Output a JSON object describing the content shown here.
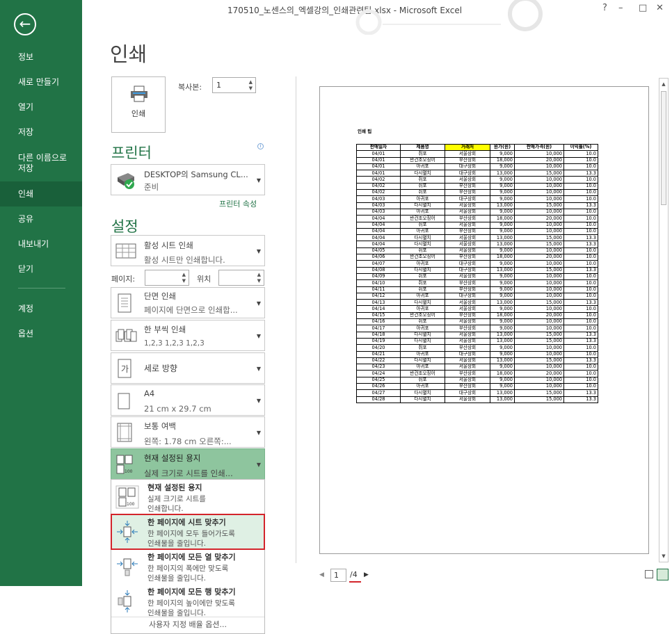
{
  "window": {
    "title": "170510_노센스의_엑셀강의_인쇄관련팁.xlsx - Microsoft Excel",
    "help": "?",
    "minimize": "–",
    "restore": "□",
    "close": "✕"
  },
  "nav": {
    "back_icon": "←",
    "items": [
      {
        "label": "정보"
      },
      {
        "label": "새로 만들기"
      },
      {
        "label": "열기"
      },
      {
        "label": "저장"
      },
      {
        "label": "다른 이름으로 저장"
      },
      {
        "label": "인쇄",
        "active": true
      },
      {
        "label": "공유"
      },
      {
        "label": "내보내기"
      },
      {
        "label": "닫기"
      },
      {
        "label": "계정"
      },
      {
        "label": "옵션"
      }
    ]
  },
  "print": {
    "heading": "인쇄",
    "print_button_label": "인쇄",
    "copies_label": "복사본:",
    "copies_value": "1",
    "printer_heading": "프린터",
    "printer_name": "DESKTOP의 Samsung CL...",
    "printer_status": "준비",
    "printer_properties": "프린터 속성",
    "settings_heading": "설정",
    "settings": {
      "what": {
        "line1": "활성 시트 인쇄",
        "line2": "활성 시트만 인쇄합니다."
      },
      "pages_label": "페이지:",
      "pages_to_label": "위치",
      "sides": {
        "line1": "단면 인쇄",
        "line2": "페이지에 단면으로 인쇄합..."
      },
      "collate": {
        "line1": "한 부씩 인쇄",
        "line2": "1,2,3    1,2,3    1,2,3"
      },
      "orientation": {
        "line1": "세로 방향"
      },
      "paper": {
        "line1": "A4",
        "line2": "21 cm x 29.7 cm"
      },
      "margins": {
        "line1": "보통 여백",
        "line2": "왼쪽:  1.78 cm    오른쪽:..."
      },
      "scaling": {
        "line1": "현재 설정된 용지",
        "line2": "실제 크기로 시트를 인쇄..."
      }
    },
    "scaling_options": [
      {
        "title": "현재 설정된 용지",
        "desc1": "실제 크기로 시트를",
        "desc2": "인쇄합니다."
      },
      {
        "title": "한 페이지에 시트 맞추기",
        "desc1": "한 페이지에 모두 들어가도록",
        "desc2": "인쇄물을 줄입니다."
      },
      {
        "title": "한 페이지에 모든 열 맞추기",
        "desc1": "한 페이지의 폭에만 맞도록",
        "desc2": "인쇄물을 줄입니다."
      },
      {
        "title": "한 페이지에 모든 행 맞추기",
        "desc1": "한 페이지의 높이에만 맞도록",
        "desc2": "인쇄물을 줄입니다."
      }
    ],
    "custom_scaling": "사용자 지정 배율 옵션..."
  },
  "preview": {
    "sheet_title": "인쇄 팁",
    "headers": [
      "판매일자",
      "제품명",
      "거래처",
      "원가(원)",
      "판매가격(원)",
      "이익률(%)"
    ],
    "highlight_header_color": "#ffff00",
    "rows": [
      [
        "04/01",
        "쥐포",
        "서울상회",
        "9,000",
        "10,000",
        "10.0"
      ],
      [
        "04/01",
        "반건조오징어",
        "부산상회",
        "18,000",
        "20,000",
        "10.0"
      ],
      [
        "04/01",
        "아귀포",
        "대구상회",
        "9,000",
        "10,000",
        "10.0"
      ],
      [
        "04/01",
        "다시멸치",
        "대구상회",
        "13,000",
        "15,000",
        "13.3"
      ],
      [
        "04/02",
        "쥐포",
        "서울상회",
        "9,000",
        "10,000",
        "10.0"
      ],
      [
        "04/02",
        "쥐포",
        "부산상회",
        "9,000",
        "10,000",
        "10.0"
      ],
      [
        "04/02",
        "쥐포",
        "부산상회",
        "9,000",
        "10,000",
        "10.0"
      ],
      [
        "04/03",
        "아귀포",
        "대구상회",
        "9,000",
        "10,000",
        "10.0"
      ],
      [
        "04/03",
        "다시멸치",
        "서울상회",
        "13,000",
        "15,000",
        "13.3"
      ],
      [
        "04/03",
        "아귀포",
        "서울상회",
        "9,000",
        "10,000",
        "10.0"
      ],
      [
        "04/04",
        "반건조오징어",
        "부산상회",
        "18,000",
        "20,000",
        "10.0"
      ],
      [
        "04/04",
        "쥐포",
        "서울상회",
        "9,000",
        "10,000",
        "10.0"
      ],
      [
        "04/04",
        "아귀포",
        "부산상회",
        "9,000",
        "10,000",
        "10.0"
      ],
      [
        "04/04",
        "다시멸치",
        "서울상회",
        "13,000",
        "15,000",
        "13.3"
      ],
      [
        "04/04",
        "다시멸치",
        "서울상회",
        "13,000",
        "15,000",
        "13.3"
      ],
      [
        "04/05",
        "쥐포",
        "서울상회",
        "9,000",
        "10,000",
        "10.0"
      ],
      [
        "04/06",
        "반건조오징어",
        "부산상회",
        "18,000",
        "20,000",
        "10.0"
      ],
      [
        "04/07",
        "아귀포",
        "대구상회",
        "9,000",
        "10,000",
        "10.0"
      ],
      [
        "04/08",
        "다시멸치",
        "대구상회",
        "13,000",
        "15,000",
        "13.3"
      ],
      [
        "04/09",
        "쥐포",
        "서울상회",
        "9,000",
        "10,000",
        "10.0"
      ],
      [
        "04/10",
        "쥐포",
        "부산상회",
        "9,000",
        "10,000",
        "10.0"
      ],
      [
        "04/11",
        "쥐포",
        "부산상회",
        "9,000",
        "10,000",
        "10.0"
      ],
      [
        "04/12",
        "아귀포",
        "대구상회",
        "9,000",
        "10,000",
        "10.0"
      ],
      [
        "04/13",
        "다시멸치",
        "서울상회",
        "13,000",
        "15,000",
        "13.3"
      ],
      [
        "04/14",
        "아귀포",
        "서울상회",
        "9,000",
        "10,000",
        "10.0"
      ],
      [
        "04/15",
        "반건조오징어",
        "부산상회",
        "18,000",
        "20,000",
        "10.0"
      ],
      [
        "04/16",
        "쥐포",
        "서울상회",
        "9,000",
        "10,000",
        "10.0"
      ],
      [
        "04/17",
        "아귀포",
        "부산상회",
        "9,000",
        "10,000",
        "10.0"
      ],
      [
        "04/18",
        "다시멸치",
        "서울상회",
        "13,000",
        "15,000",
        "13.3"
      ],
      [
        "04/19",
        "다시멸치",
        "서울상회",
        "13,000",
        "15,000",
        "13.3"
      ],
      [
        "04/20",
        "쥐포",
        "부산상회",
        "9,000",
        "10,000",
        "10.0"
      ],
      [
        "04/21",
        "아귀포",
        "대구상회",
        "9,000",
        "10,000",
        "10.0"
      ],
      [
        "04/22",
        "다시멸치",
        "서울상회",
        "13,000",
        "15,000",
        "13.3"
      ],
      [
        "04/23",
        "아귀포",
        "서울상회",
        "9,000",
        "10,000",
        "10.0"
      ],
      [
        "04/24",
        "반건조오징어",
        "부산상회",
        "18,000",
        "20,000",
        "10.0"
      ],
      [
        "04/25",
        "쥐포",
        "서울상회",
        "9,000",
        "10,000",
        "10.0"
      ],
      [
        "04/26",
        "아귀포",
        "부산상회",
        "9,000",
        "10,000",
        "10.0"
      ],
      [
        "04/27",
        "다시멸치",
        "대구상회",
        "13,000",
        "15,000",
        "13.3"
      ],
      [
        "04/28",
        "다시멸치",
        "서울상회",
        "13,000",
        "15,000",
        "13.3"
      ]
    ],
    "page_current": "1",
    "page_total": "/4"
  }
}
